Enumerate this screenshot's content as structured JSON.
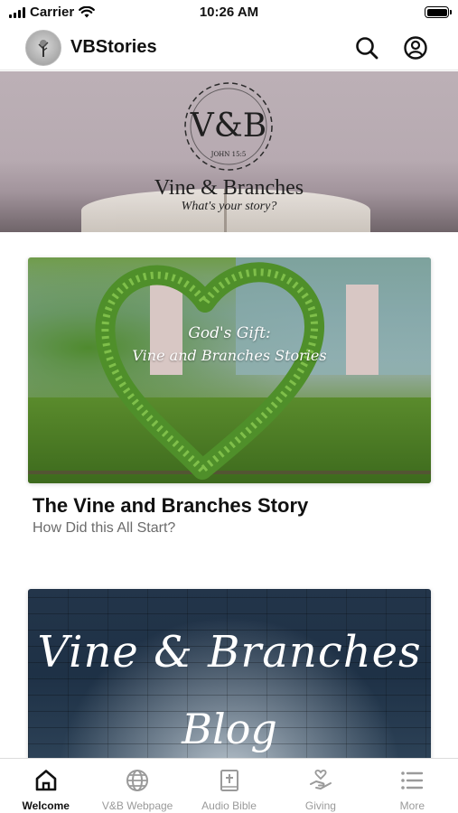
{
  "status_bar": {
    "carrier": "Carrier",
    "time": "10:26 AM"
  },
  "header": {
    "title": "VBStories"
  },
  "hero": {
    "title": "Vine & Branches",
    "subtitle": "What's your story?",
    "logo_monogram": "V&B",
    "logo_ring_text": "JOHN 15:5"
  },
  "cards": [
    {
      "image_caption_1": "God's Gift:",
      "image_caption_2": "Vine and Branches Stories",
      "title": "The Vine and Branches Story",
      "subtitle": "How Did this All Start?"
    },
    {
      "image_caption_1": "Vine & Branches",
      "image_caption_2": "Blog"
    }
  ],
  "tabs": [
    {
      "label": "Welcome",
      "icon": "home-icon",
      "active": true
    },
    {
      "label": "V&B Webpage",
      "icon": "globe-icon",
      "active": false
    },
    {
      "label": "Audio Bible",
      "icon": "bible-icon",
      "active": false
    },
    {
      "label": "Giving",
      "icon": "giving-hand-icon",
      "active": false
    },
    {
      "label": "More",
      "icon": "list-icon",
      "active": false
    }
  ],
  "colors": {
    "active_tab": "#111111",
    "inactive_tab": "#9a9a9a"
  }
}
